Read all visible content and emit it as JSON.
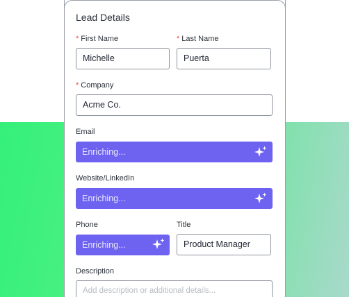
{
  "form": {
    "title": "Lead Details",
    "required_marker": "*",
    "first_name": {
      "label": "First Name",
      "value": "Michelle"
    },
    "last_name": {
      "label": "Last Name",
      "value": "Puerta"
    },
    "company": {
      "label": "Company",
      "value": "Acme Co."
    },
    "email": {
      "label": "Email",
      "status": "Enriching..."
    },
    "website": {
      "label": "Website/LinkedIn",
      "status": "Enriching..."
    },
    "phone": {
      "label": "Phone",
      "status": "Enriching..."
    },
    "job_title": {
      "label": "Title",
      "value": "Product Manager"
    },
    "description": {
      "label": "Description",
      "placeholder": "Add description or additional details..."
    }
  },
  "icons": {
    "enrich": "sparkles-icon"
  },
  "colors": {
    "accent": "#6e63f0",
    "required": "#e8473f",
    "gradient_start": "#34f07a",
    "gradient_end": "#a9d9cb"
  }
}
